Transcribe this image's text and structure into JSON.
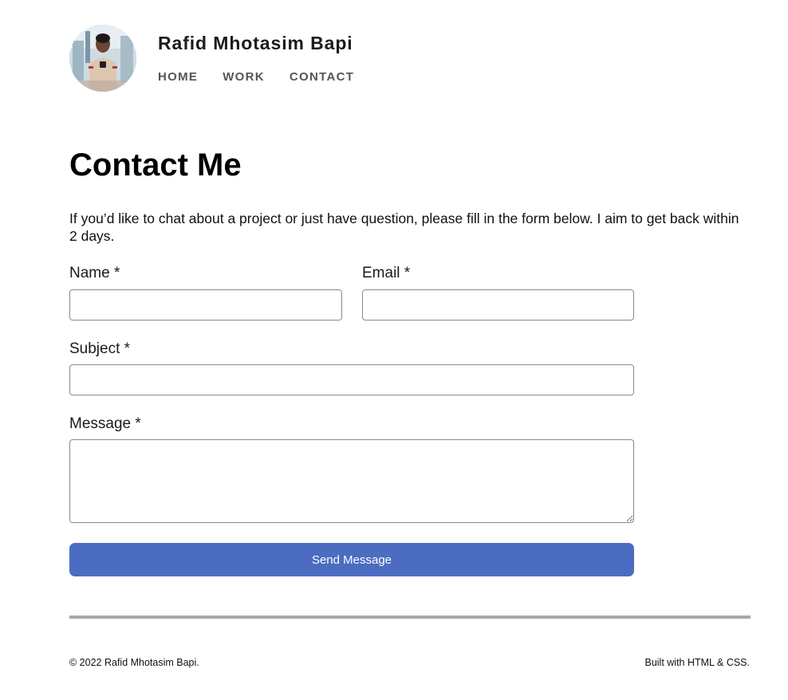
{
  "header": {
    "site_name": "Rafid Mhotasim Bapi",
    "nav": [
      {
        "label": "HOME"
      },
      {
        "label": "WORK"
      },
      {
        "label": "CONTACT"
      }
    ]
  },
  "main": {
    "title": "Contact Me",
    "intro": "If you’d like to chat about a project or just have question, please fill in the form below. I aim to get back within 2 days.",
    "form": {
      "name_label": "Name *",
      "name_value": "",
      "email_label": "Email *",
      "email_value": "",
      "subject_label": "Subject *",
      "subject_value": "",
      "message_label": "Message *",
      "message_value": "",
      "submit_label": "Send Message"
    }
  },
  "footer": {
    "copyright": "© 2022 Rafid Mhotasim Bapi.",
    "built_with": "Built with HTML & CSS."
  },
  "colors": {
    "accent": "#4b6cc1",
    "nav_text": "#555555",
    "divider": "#a9a9a9"
  }
}
